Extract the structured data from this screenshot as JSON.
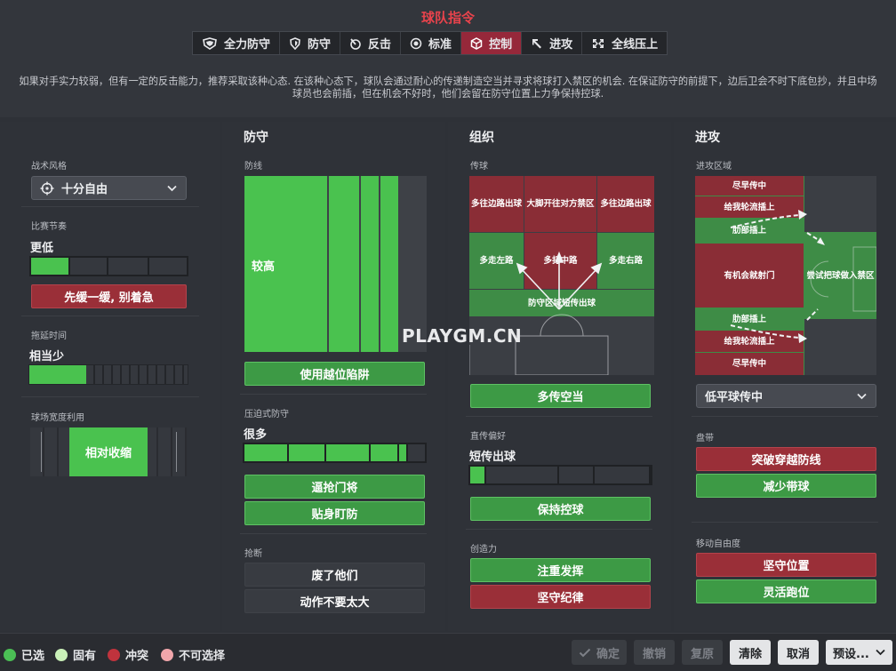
{
  "header": {
    "title": "球队指令",
    "mentality_tabs": [
      {
        "label": "全力防守",
        "icon": "shield-double-icon"
      },
      {
        "label": "防守",
        "icon": "shield-icon"
      },
      {
        "label": "反击",
        "icon": "counter-icon"
      },
      {
        "label": "标准",
        "icon": "target-icon"
      },
      {
        "label": "控制",
        "icon": "cube-icon",
        "active": true
      },
      {
        "label": "进攻",
        "icon": "attack-arrow-icon"
      },
      {
        "label": "全线压上",
        "icon": "all-out-icon"
      }
    ],
    "description": "如果对手实力较弱，但有一定的反击能力，推荐采取该种心态. 在该种心态下，球队会通过耐心的传递制造空当并寻求将球打入禁区的机会. 在保证防守的前提下，边后卫会不时下底包抄，并且中场球员也会前插，但在机会不好时，他们会留在防守位置上力争保持控球."
  },
  "left": {
    "style_label": "战术风格",
    "style_value": "十分自由",
    "tempo_label": "比赛节奏",
    "tempo_value": "更低",
    "tempo_level": 0.12,
    "tempo_button": "先缓一缓, 别着急",
    "timewasting_label": "拖延时间",
    "timewasting_value": "相当少",
    "timewasting_level": 0.36,
    "width_label": "球场宽度利用",
    "width_value": "相对收缩"
  },
  "defense": {
    "head": "防守",
    "line_label": "防线",
    "line_value": "较高",
    "offside_button": "使用越位陷阱",
    "press_label": "压迫式防守",
    "press_value": "很多",
    "press_level": 0.84,
    "press_buttons": [
      "逼抢门将",
      "贴身盯防"
    ],
    "tackle_label": "抢断",
    "tackle_buttons": [
      "废了他们",
      "动作不要太大"
    ]
  },
  "organize": {
    "head": "组织",
    "passing_label": "传球",
    "zones": {
      "left_wing": "多往边路出球",
      "long_ball": "大脚开往对方禁区",
      "right_wing": "多往边路出球",
      "left_flank": "多走左路",
      "middle": "多打中路",
      "right_flank": "多走右路",
      "play_out": "防守区域短传出球"
    },
    "space_button": "多传空当",
    "directness_label": "直传偏好",
    "directness_value": "短传出球",
    "directness_level": 0.1,
    "possession_button": "保持控球",
    "creativity_label": "创造力",
    "creativity_buttons": [
      "注重发挥",
      "坚守纪律"
    ]
  },
  "attack": {
    "head": "进攻",
    "area_label": "进攻区域",
    "zones": {
      "early_cross_top": "尽早传中",
      "overlap_top": "给我轮流插上",
      "underlap_top": "肋部插上",
      "shoot": "有机会就射门",
      "work_box": "尝试把球做入禁区",
      "underlap_bottom": "肋部插上",
      "overlap_bottom": "给我轮流插上",
      "early_cross_bottom": "尽早传中"
    },
    "cross_select": "低平球传中",
    "dribble_label": "盘带",
    "dribble_buttons": [
      "突破穿越防线",
      "减少带球"
    ],
    "freedom_label": "移动自由度",
    "freedom_buttons": [
      "坚守位置",
      "灵活跑位"
    ]
  },
  "legend": [
    {
      "label": "已选",
      "color": "#4bbf55"
    },
    {
      "label": "固有",
      "color": "#c9f0b8"
    },
    {
      "label": "冲突",
      "color": "#c0333d"
    },
    {
      "label": "不可选择",
      "color": "#f1a6ab"
    }
  ],
  "footer": {
    "confirm": "确定",
    "undo": "撤销",
    "redo": "复原",
    "clear": "清除",
    "cancel": "取消",
    "preset": "预设..."
  },
  "watermark": "PLAYGM.CN",
  "colors": {
    "accent": "#96283a",
    "selected": "#3d9a45",
    "conflict": "#9a2f38"
  }
}
